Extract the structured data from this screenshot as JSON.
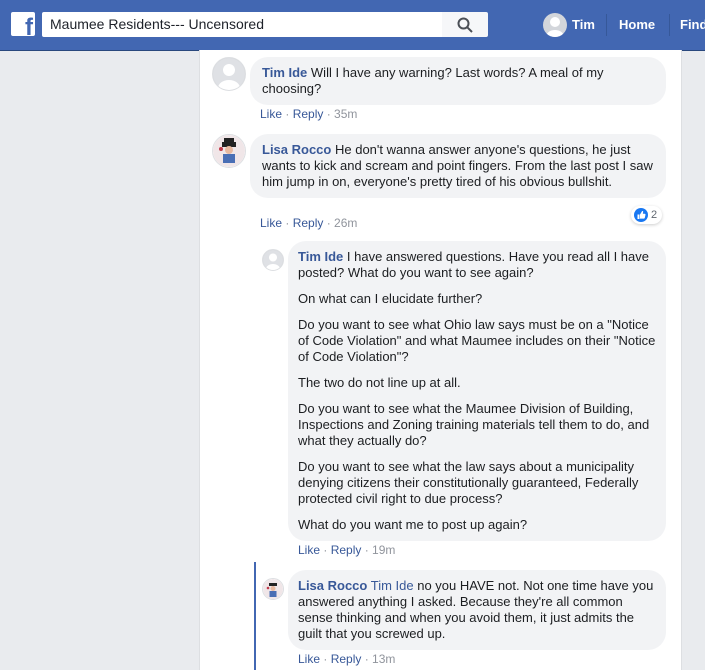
{
  "header": {
    "search_value": "Maumee Residents--- Uncensored",
    "user_name": "Tim",
    "nav_home": "Home",
    "nav_find": "Find"
  },
  "comments": [
    {
      "author": "Tim Ide",
      "text": "Will I have any warning? Last words? A meal of my choosing?",
      "like": "Like",
      "reply": "Reply",
      "time": "35m"
    },
    {
      "author": "Lisa Rocco",
      "text": "He don't wanna answer anyone's questions, he just wants to kick and scream and point fingers. From the last post I saw him jump in on, everyone's pretty tired of his obvious bullshit.",
      "like": "Like",
      "reply": "Reply",
      "time": "26m",
      "reaction_count": "2"
    }
  ],
  "replies": [
    {
      "author": "Tim Ide",
      "paragraphs": [
        "I have answered questions. Have you read all I have posted? What do you want to see again?",
        "On what can I elucidate further?",
        "Do you want to see what Ohio law says must be on a \"Notice of Code Violation\" and what Maumee includes on their \"Notice of Code Violation\"?",
        "The two do not line up at all.",
        "Do you want to see what the Maumee Division of Building, Inspections and Zoning training materials tell them to do, and what they actually do?",
        "Do you want to see what the law says about a municipality denying citizens their constitutionally guaranteed, Federally protected civil right to due process?",
        "What do you want me to post up again?"
      ],
      "like": "Like",
      "reply": "Reply",
      "time": "19m"
    },
    {
      "author": "Lisa Rocco",
      "mention": "Tim Ide",
      "text": "no you HAVE not. Not one time have you answered anything I asked. Because they're all common sense thinking and when you avoid them, it just admits the guilt that you screwed up.",
      "like": "Like",
      "reply": "Reply",
      "time": "13m"
    }
  ],
  "separator": " · ",
  "colors": {
    "brand": "#4267b2",
    "link": "#385898",
    "bubble": "#f2f3f5",
    "meta": "#90949c"
  }
}
